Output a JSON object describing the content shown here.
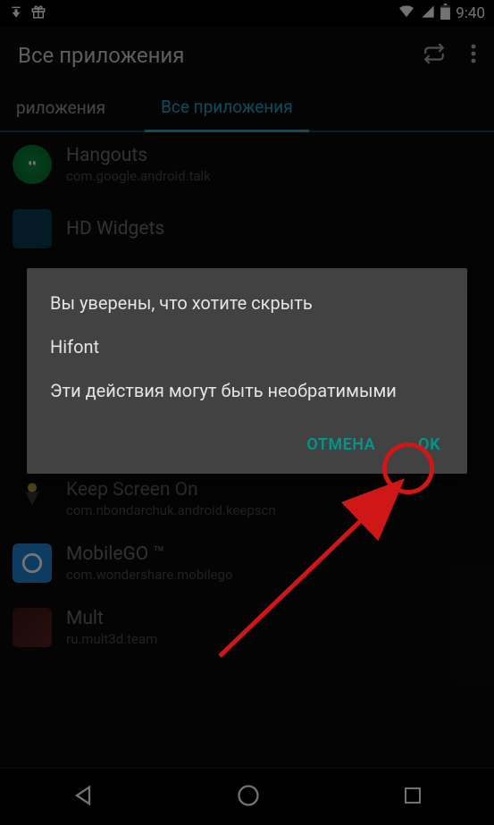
{
  "status": {
    "time": "9:40"
  },
  "header": {
    "title": "Все приложения"
  },
  "tabs": {
    "left": "риложения",
    "active": "Все приложения"
  },
  "apps": {
    "items": [
      {
        "name": "Hangouts",
        "pkg": "com.google.android.talk"
      },
      {
        "name": "HD Widgets",
        "pkg": ""
      },
      {
        "name": "Keep Screen On",
        "pkg": "com.nbondarchuk.android.keepscn"
      },
      {
        "name": "MobileGO ™",
        "pkg": "com.wondershare.mobilego"
      },
      {
        "name": "Mult",
        "pkg": "ru.mult3d.team"
      }
    ]
  },
  "dialog": {
    "line1": "Вы уверены, что хотите скрыть",
    "line2": "Hifont",
    "line3": "Эти действия могут быть необратимыми",
    "cancel": "ОТМЕНА",
    "ok": "OK"
  }
}
